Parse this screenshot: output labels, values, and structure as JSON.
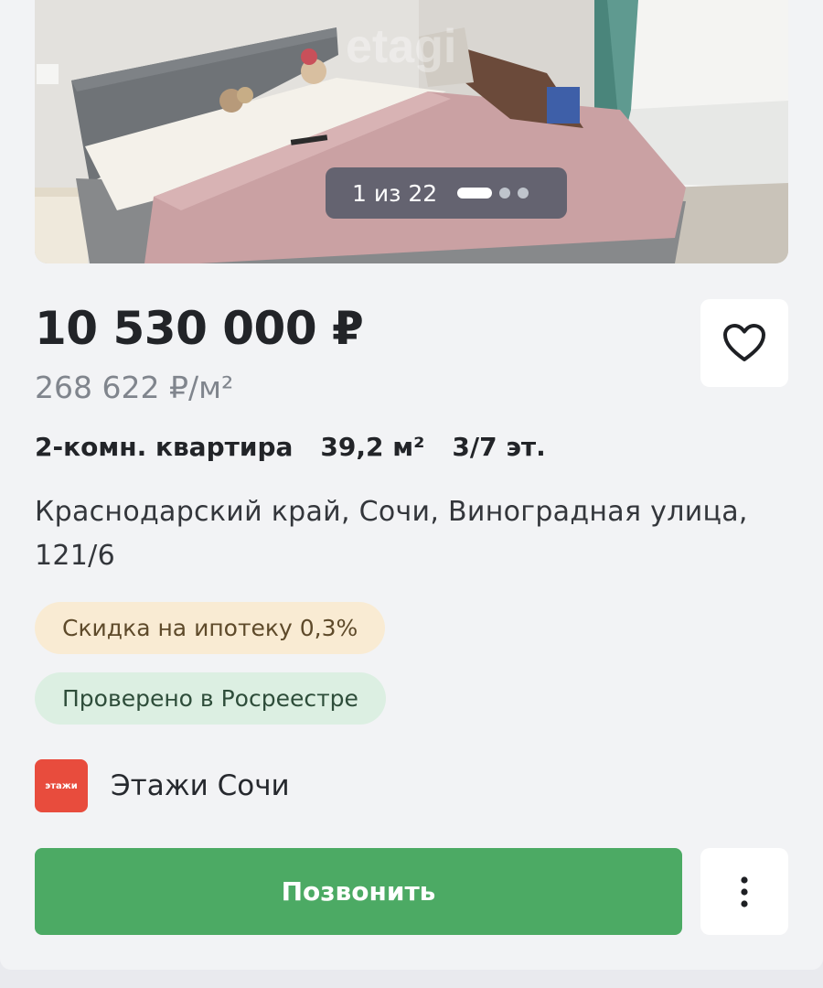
{
  "gallery": {
    "counter_text": "1 из 22",
    "watermark": "etagi"
  },
  "listing": {
    "price": "10 530 000 ₽",
    "price_per_m2": "268 622 ₽/м²",
    "specs": {
      "type": "2-комн. квартира",
      "area": "39,2 м²",
      "floor": "3/7 эт."
    },
    "address": "Краснодарский край, Сочи, Виноградная улица, 121/6",
    "tags": {
      "mortgage": "Скидка на ипотеку 0,3%",
      "verified": "Проверено в Росреестре"
    }
  },
  "agency": {
    "logo_text": "этажи",
    "name": "Этажи Сочи"
  },
  "actions": {
    "call_label": "Позвонить",
    "favorite_icon": "heart-outline-icon",
    "more_icon": "vertical-dots-icon"
  },
  "colors": {
    "call_button": "#4caa64",
    "agency_logo": "#e84c3d",
    "mortgage_tag_bg": "#f9ebd3",
    "verified_tag_bg": "#dcefe2"
  }
}
